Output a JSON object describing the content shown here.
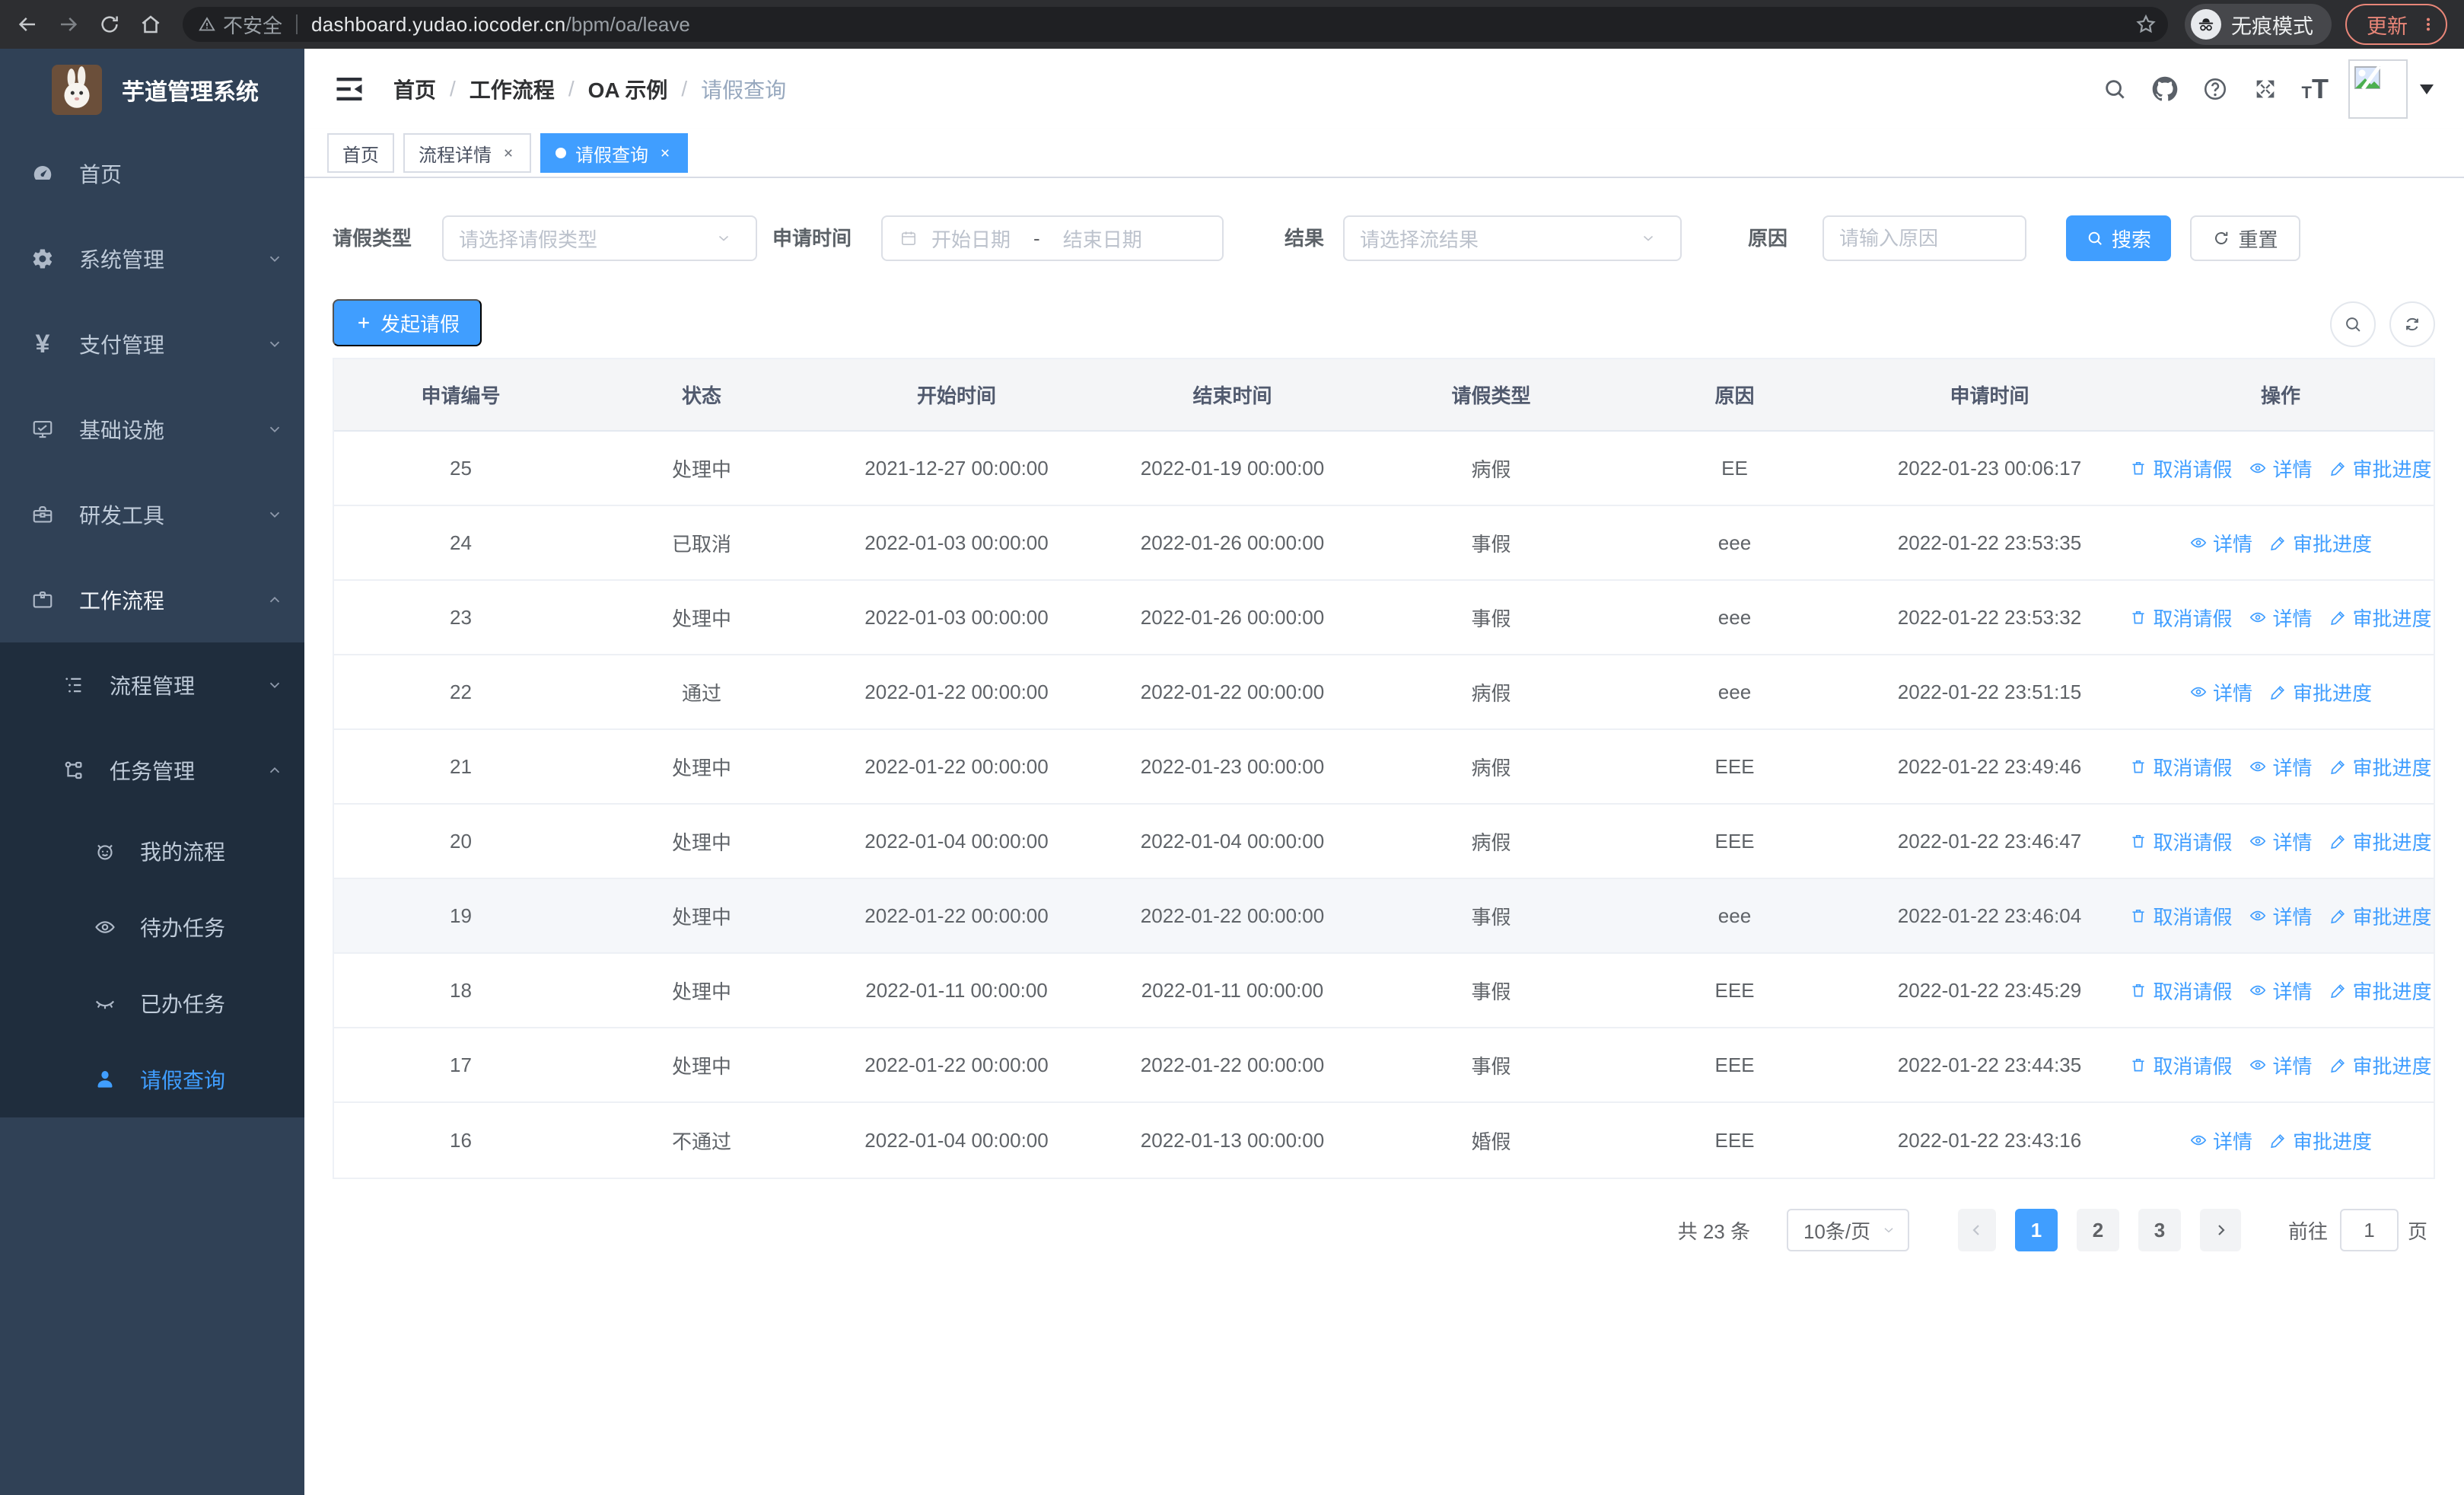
{
  "browser": {
    "security_label": "不安全",
    "url_host": "dashboard.yudao.iocoder.cn",
    "url_path": "/bpm/oa/leave",
    "incognito_label": "无痕模式",
    "update_label": "更新"
  },
  "sidebar": {
    "app_title": "芋道管理系统",
    "top_items": [
      {
        "label": "首页"
      },
      {
        "label": "系统管理"
      },
      {
        "label": "支付管理"
      },
      {
        "label": "基础设施"
      },
      {
        "label": "研发工具"
      },
      {
        "label": "工作流程"
      }
    ],
    "submenu": [
      {
        "label": "流程管理"
      },
      {
        "label": "任务管理"
      }
    ],
    "task_items": [
      {
        "label": "我的流程"
      },
      {
        "label": "待办任务"
      },
      {
        "label": "已办任务"
      },
      {
        "label": "请假查询"
      }
    ]
  },
  "header": {
    "breadcrumb": [
      "首页",
      "工作流程",
      "OA 示例",
      "请假查询"
    ],
    "separator": "/"
  },
  "tabs": [
    {
      "label": "首页"
    },
    {
      "label": "流程详情"
    },
    {
      "label": "请假查询"
    }
  ],
  "filters": {
    "leave_type_label": "请假类型",
    "leave_type_placeholder": "请选择请假类型",
    "apply_time_label": "申请时间",
    "start_date_placeholder": "开始日期",
    "range_separator": "-",
    "end_date_placeholder": "结束日期",
    "result_label": "结果",
    "result_placeholder": "请选择流结果",
    "reason_label": "原因",
    "reason_placeholder": "请输入原因",
    "search_label": "搜索",
    "reset_label": "重置"
  },
  "toolbar": {
    "create_label": "发起请假"
  },
  "actions": {
    "cancel": "取消请假",
    "detail": "详情",
    "progress": "审批进度"
  },
  "table": {
    "columns": [
      "申请编号",
      "状态",
      "开始时间",
      "结束时间",
      "请假类型",
      "原因",
      "申请时间",
      "操作"
    ],
    "rows": [
      {
        "id": "25",
        "status": "处理中",
        "start": "2021-12-27 00:00:00",
        "end": "2022-01-19 00:00:00",
        "type": "病假",
        "reason": "EE",
        "applied": "2022-01-23 00:06:17"
      },
      {
        "id": "24",
        "status": "已取消",
        "start": "2022-01-03 00:00:00",
        "end": "2022-01-26 00:00:00",
        "type": "事假",
        "reason": "eee",
        "applied": "2022-01-22 23:53:35"
      },
      {
        "id": "23",
        "status": "处理中",
        "start": "2022-01-03 00:00:00",
        "end": "2022-01-26 00:00:00",
        "type": "事假",
        "reason": "eee",
        "applied": "2022-01-22 23:53:32"
      },
      {
        "id": "22",
        "status": "通过",
        "start": "2022-01-22 00:00:00",
        "end": "2022-01-22 00:00:00",
        "type": "病假",
        "reason": "eee",
        "applied": "2022-01-22 23:51:15"
      },
      {
        "id": "21",
        "status": "处理中",
        "start": "2022-01-22 00:00:00",
        "end": "2022-01-23 00:00:00",
        "type": "病假",
        "reason": "EEE",
        "applied": "2022-01-22 23:49:46"
      },
      {
        "id": "20",
        "status": "处理中",
        "start": "2022-01-04 00:00:00",
        "end": "2022-01-04 00:00:00",
        "type": "病假",
        "reason": "EEE",
        "applied": "2022-01-22 23:46:47"
      },
      {
        "id": "19",
        "status": "处理中",
        "start": "2022-01-22 00:00:00",
        "end": "2022-01-22 00:00:00",
        "type": "事假",
        "reason": "eee",
        "applied": "2022-01-22 23:46:04"
      },
      {
        "id": "18",
        "status": "处理中",
        "start": "2022-01-11 00:00:00",
        "end": "2022-01-11 00:00:00",
        "type": "事假",
        "reason": "EEE",
        "applied": "2022-01-22 23:45:29"
      },
      {
        "id": "17",
        "status": "处理中",
        "start": "2022-01-22 00:00:00",
        "end": "2022-01-22 00:00:00",
        "type": "事假",
        "reason": "EEE",
        "applied": "2022-01-22 23:44:35"
      },
      {
        "id": "16",
        "status": "不通过",
        "start": "2022-01-04 00:00:00",
        "end": "2022-01-13 00:00:00",
        "type": "婚假",
        "reason": "EEE",
        "applied": "2022-01-22 23:43:16"
      }
    ]
  },
  "pagination": {
    "total_label": "共 23 条",
    "page_size": "10条/页",
    "pages": [
      "1",
      "2",
      "3"
    ],
    "active_page": "1",
    "goto_label": "前往",
    "goto_value": "1",
    "page_unit": "页"
  },
  "icons": {
    "yen_glyph": "¥",
    "font_small": "T",
    "font_big": "T",
    "close_glyph": "×"
  },
  "colors": {
    "accent": "#409eff",
    "sidebar_bg": "#304156",
    "submenu_bg": "#1f2d3d",
    "chrome_bg": "#2d2e31",
    "update_accent": "#e98678",
    "table_header_bg": "#f4f5f7"
  }
}
